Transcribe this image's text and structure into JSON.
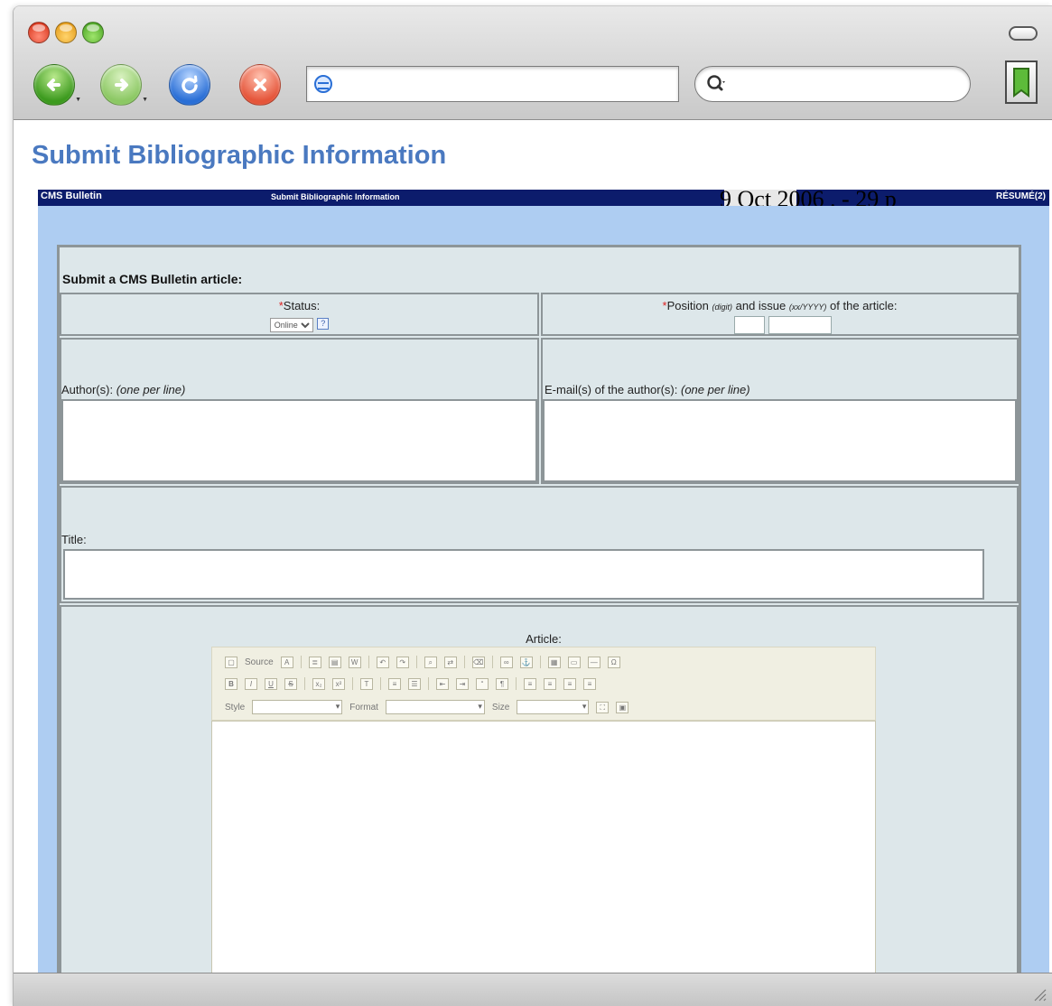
{
  "browser": {
    "address": {
      "value": "",
      "placeholder": ""
    },
    "search": {
      "value": "",
      "placeholder": ""
    }
  },
  "page": {
    "title": "Submit Bibliographic Information",
    "header_bar": {
      "name": "CMS Bulletin",
      "subtitle": "Submit Bibliographic Information",
      "resume": "RÉSUMÉ(2)"
    },
    "overlay_date": "9 Oct 2006 . - 29 p"
  },
  "form": {
    "heading": "Submit a CMS Bulletin article:",
    "required_mark": "*",
    "status": {
      "label": "Status:",
      "selected": "Online",
      "options": [
        "Online"
      ],
      "help": "?"
    },
    "position": {
      "label_a": "Position",
      "hint_a": "(digit)",
      "label_b": "and issue",
      "hint_b": "(xx/YYYY)",
      "label_c": "of the article:"
    },
    "authors": {
      "label": "Author(s):",
      "hint": "(one per line)"
    },
    "emails": {
      "label": "E-mail(s) of the author(s):",
      "hint": "(one per line)"
    },
    "title": {
      "label": "Title:"
    },
    "article": {
      "label": "Article:",
      "toolbar": {
        "source": "Source",
        "style": "Style",
        "format": "Format",
        "size": "Size"
      }
    }
  },
  "colors": {
    "title_blue": "#4a79c0",
    "header_navy": "#0c1c6c",
    "frame_blue": "#aecdf2",
    "form_bg": "#dde7ea",
    "required_red": "#d22"
  }
}
